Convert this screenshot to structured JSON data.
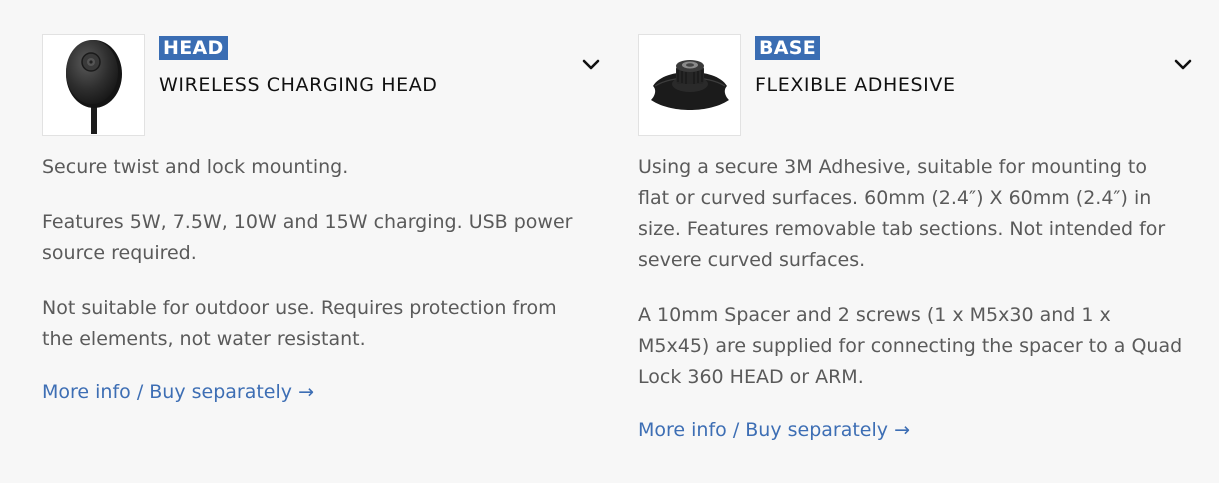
{
  "products": [
    {
      "badge": "HEAD",
      "title": "WIRELESS CHARGING HEAD",
      "thumbnail_icon": "wireless-charger-icon",
      "paragraphs": [
        "Secure twist and lock mounting.",
        "Features 5W, 7.5W, 10W and 15W charging. USB power source required.",
        "Not suitable for outdoor use. Requires protection from the elements, not water resistant."
      ],
      "link_text": "More info / Buy separately →"
    },
    {
      "badge": "BASE",
      "title": "FLEXIBLE ADHESIVE",
      "thumbnail_icon": "adhesive-mount-icon",
      "paragraphs": [
        "Using a secure 3M Adhesive, suitable for mounting to flat or curved surfaces. 60mm (2.4″) X 60mm (2.4″) in size. Features removable tab sections. Not intended for severe curved surfaces.",
        "A 10mm Spacer and 2 screws (1 x M5x30 and 1 x M5x45) are supplied for connecting the spacer to a Quad Lock 360 HEAD or ARM."
      ],
      "link_text": "More info / Buy separately →"
    }
  ],
  "colors": {
    "background": "#f7f7f7",
    "badge": "#3a6db3",
    "link": "#3d6eb4",
    "body_text": "#5a5a5a",
    "title_text": "#111111"
  }
}
